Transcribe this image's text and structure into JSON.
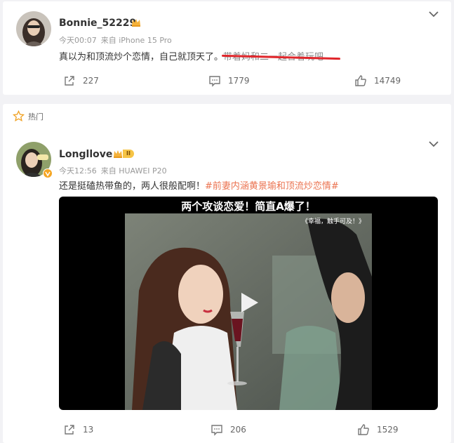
{
  "posts": [
    {
      "username": "Bonnie_52229",
      "time": "今天00:07",
      "source": "来自 iPhone 15 Pro",
      "text_main": "真以为和顶流炒个恋情，自己就顶天了。",
      "text_struck": "带着妈和二一起合着玩吧",
      "actions": {
        "share": "227",
        "comment": "1779",
        "like": "14749"
      }
    },
    {
      "hot_label": "热门",
      "username": "Longllove",
      "time": "今天12:56",
      "source": "来自 HUAWEI P20",
      "level_badge": "II",
      "text_main": "还是挺磕热带鱼的，两人很般配啊！",
      "hashtag": "#前妻内涵黄景瑜和顶流炒恋情#",
      "video": {
        "banner": "两个攻谈恋爱！简直A爆了！",
        "subtitle": "《幸福，触手可及！》"
      },
      "actions": {
        "share": "13",
        "comment": "206",
        "like": "1529"
      }
    }
  ],
  "colors": {
    "accent": "#eb7350",
    "strike": "#e0262b",
    "meta": "#999999"
  }
}
